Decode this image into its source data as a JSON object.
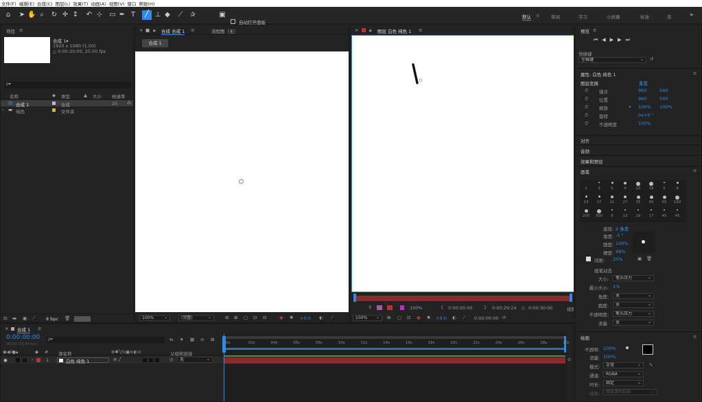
{
  "menu": [
    "文件(F)",
    "编辑(E)",
    "合成(C)",
    "图层(L)",
    "效果(T)",
    "动画(A)",
    "视图(V)",
    "窗口",
    "帮助(H)"
  ],
  "toolbar": {
    "auto_open_label": "自动打开面板"
  },
  "workspaces": [
    "默认",
    "审阅",
    "学习",
    "小屏幕",
    "标准",
    "库"
  ],
  "project": {
    "tab": "项目",
    "comp_name": "合成 1▾",
    "comp_info1": "1920 x 1080 (1.00)",
    "comp_info2": "△ 0:00:30:00, 25.00 fps",
    "search_placeholder": "ρ▾",
    "col_name": "名称",
    "col_type": "类型",
    "col_size": "大小",
    "col_rate": "帧速率",
    "rows": [
      {
        "name": "合成 1",
        "type": "合成",
        "rate": "25"
      },
      {
        "name": "纯色",
        "type": "文件夹",
        "rate": ""
      }
    ],
    "bpc": "8 bpc"
  },
  "comp_viewer": {
    "tab": "合成 合成 1",
    "tab2": "流程图（无）",
    "crumb": "合成 1",
    "zoom": "100%",
    "quality": "(完整)",
    "exposure": "+0.0"
  },
  "layer_viewer": {
    "tab": "图层 白色 纯色 1",
    "zoom": "100%",
    "exposure": "+0.0",
    "t_start": "0:00:00:00",
    "t_end": "0:00:29:24",
    "t_dur": "0:00:30:00",
    "t_cur": "0:00:00:00",
    "trim_label": "视图",
    "mini_pct": "100%"
  },
  "preview": {
    "title": "预览",
    "shortcut_label": "快捷键",
    "shortcut_value": "空格键"
  },
  "properties": {
    "title": "属性: 白色 纯色 1",
    "group": "图层变换",
    "reset": "重置",
    "items": [
      {
        "label": "锚点",
        "v1": "960",
        "v2": "540"
      },
      {
        "label": "位置",
        "v1": "960",
        "v2": "540"
      },
      {
        "label": "缩放",
        "v1": "100%",
        "v2": "100%"
      },
      {
        "label": "旋转",
        "v1": "0x+0 °",
        "v2": ""
      },
      {
        "label": "不透明度",
        "v1": "100%",
        "v2": ""
      }
    ]
  },
  "sections": [
    "对齐",
    "音频",
    "效果和预设"
  ],
  "brushes": {
    "title": "画笔",
    "row1": [
      "1",
      "3",
      "5",
      "9",
      "13",
      "19",
      "5",
      "9"
    ],
    "row2": [
      "13",
      "17",
      "21",
      "27",
      "35",
      "45",
      "65",
      "100"
    ],
    "row3": [
      "200",
      "300",
      "9",
      "13",
      "19",
      "17",
      "45",
      "45"
    ],
    "diameter_label": "直径:",
    "diameter": "9 像素",
    "angle_label": "角度:",
    "angle": "-1 °",
    "roundness_label": "圆度:",
    "roundness": "100%",
    "hardness_label": "硬度:",
    "hardness": "99%",
    "spacing_label": "间距:",
    "spacing": "25%",
    "dynamics": "画笔动态",
    "dyn": [
      {
        "label": "大小:",
        "value": "笔头压力"
      },
      {
        "label": "最小大小:",
        "value": "1%"
      },
      {
        "label": "角度:",
        "value": "关"
      },
      {
        "label": "圆度:",
        "value": "关"
      },
      {
        "label": "不透明度:",
        "value": "笔头压力"
      },
      {
        "label": "流量:",
        "value": "关"
      }
    ]
  },
  "paint": {
    "title": "绘画",
    "opacity_label": "不透明:",
    "opacity": "100%",
    "flow_label": "流量:",
    "flow": "100%",
    "mode_label": "模式:",
    "mode": "正常",
    "channel_label": "通道:",
    "channel": "RGBA",
    "duration_label": "时长:",
    "duration": "固定",
    "erase_label": "抹除:",
    "erase": "图层源和绘画"
  },
  "timeline": {
    "tab": "合成 1",
    "timecode": "0:00:00:00",
    "frame_info": "00000 (25.00 fps)",
    "search_placeholder": "ρ▾",
    "col_source": "源名称",
    "col_parent": "父级和链接",
    "layer_index": "1",
    "layer_name": "白色 纯色 1",
    "parent": "无",
    "ticks": [
      "0s",
      "02s",
      "04s",
      "06s",
      "08s",
      "10s",
      "12s",
      "14s",
      "16s",
      "18s",
      "20s",
      "22s",
      "24s",
      "26s",
      "28s",
      "30s"
    ]
  },
  "colors": {
    "accent": "#2d8ceb",
    "layer_bar": "#8a2a2a",
    "menubar": "#ffffff"
  }
}
